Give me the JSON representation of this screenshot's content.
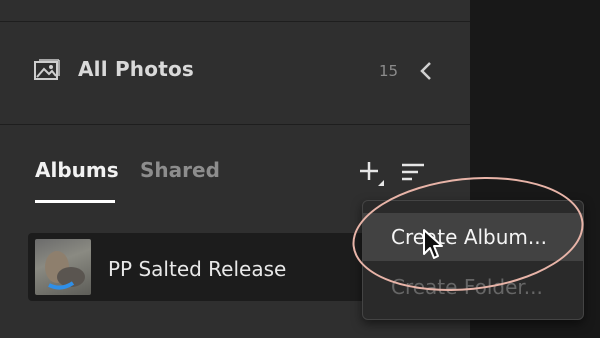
{
  "all_photos": {
    "label": "All Photos",
    "count": "15"
  },
  "tabs": [
    {
      "label": "Albums",
      "active": true
    },
    {
      "label": "Shared",
      "active": false
    }
  ],
  "toolbar": {
    "add_icon": "plus-icon",
    "sort_icon": "sort-icon"
  },
  "album": {
    "name": "PP Salted Release"
  },
  "menu": {
    "items": [
      {
        "label": "Create Album...",
        "state": "highlighted"
      },
      {
        "label": "Create Folder...",
        "state": "disabled"
      }
    ]
  },
  "colors": {
    "sidebar": "#2f2f2f",
    "annotation": "#e8b4a8",
    "thumb_accent": "#2f8fe8"
  }
}
